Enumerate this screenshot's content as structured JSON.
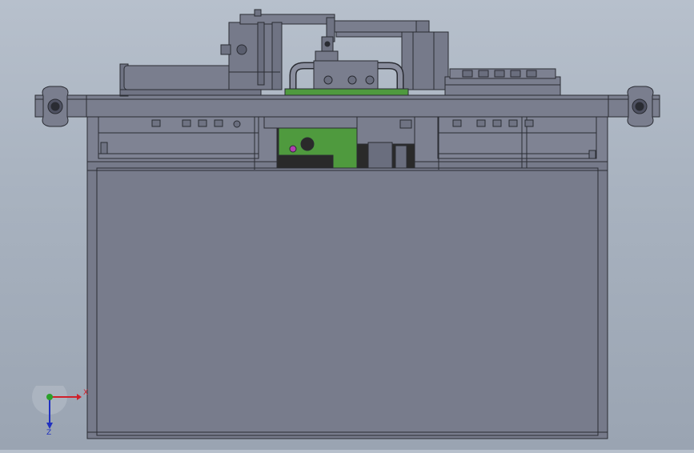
{
  "app": {
    "view": "front-elevation"
  },
  "triad": {
    "x_label": "X",
    "z_label": "Z",
    "x_color": "#d0202a",
    "y_color": "#2aa02a",
    "z_color": "#2030c0"
  },
  "colors": {
    "background_top": "#b7c0cc",
    "background_bottom": "#9aa4b2",
    "frame": "#767a8a",
    "frame_edge": "#2a2c33",
    "pcb_green": "#4f9a3e",
    "motor_dark": "#2a2a2a"
  }
}
